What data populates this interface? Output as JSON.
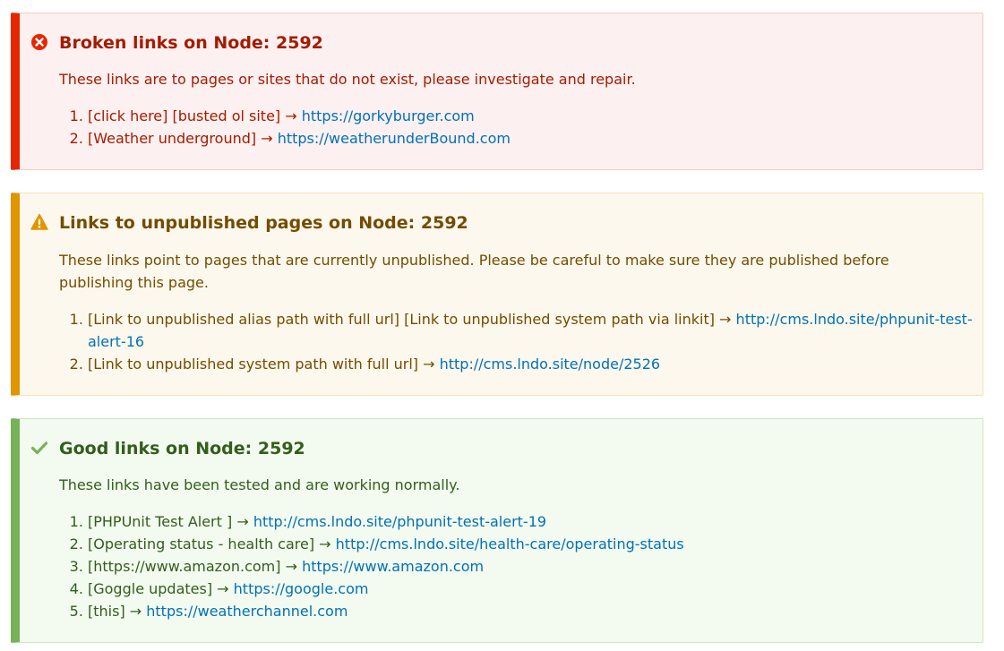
{
  "colors": {
    "error_accent": "#e62600",
    "warning_accent": "#e09600",
    "success_accent": "#77b259",
    "link": "#0071b8"
  },
  "broken": {
    "icon": "error-circle-icon",
    "title": "Broken links on Node: 2592",
    "description": "These links are to pages or sites that do not exist, please investigate and repair.",
    "items": [
      {
        "text": "[click here] [busted ol site] → ",
        "link": "https://gorkyburger.com"
      },
      {
        "text": "[Weather underground] → ",
        "link": "https://weatherunderBound.com"
      }
    ]
  },
  "unpublished": {
    "icon": "warning-triangle-icon",
    "title": "Links to unpublished pages on Node: 2592",
    "description": "These links point to pages that are currently unpublished. Please be careful to make sure they are published before publishing this page.",
    "items": [
      {
        "text": "[Link to unpublished alias path with full url] [Link to unpublished system path via linkit] → ",
        "link": "http://cms.lndo.site/phpunit-test-alert-16"
      },
      {
        "text": "[Link to unpublished system path with full url] → ",
        "link": "http://cms.lndo.site/node/2526"
      }
    ]
  },
  "good": {
    "icon": "checkmark-icon",
    "title": "Good links on Node: 2592",
    "description": "These links have been tested and are working normally.",
    "items": [
      {
        "text": "[PHPUnit Test Alert ] → ",
        "link": "http://cms.lndo.site/phpunit-test-alert-19"
      },
      {
        "text": "[Operating status - health care] → ",
        "link": "http://cms.lndo.site/health-care/operating-status"
      },
      {
        "text": "[https://www.amazon.com] → ",
        "link": "https://www.amazon.com"
      },
      {
        "text": "[Goggle updates] → ",
        "link": "https://google.com"
      },
      {
        "text": "[this] → ",
        "link": "https://weatherchannel.com"
      }
    ]
  }
}
